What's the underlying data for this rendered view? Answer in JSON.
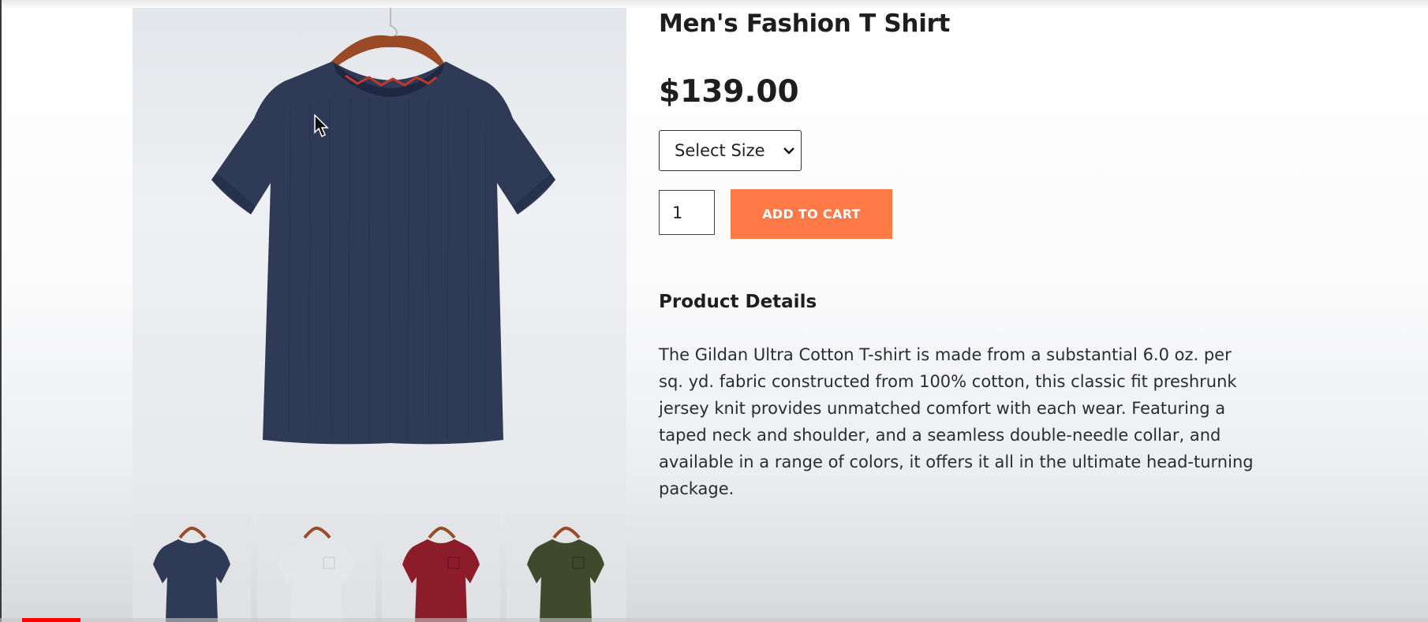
{
  "product": {
    "title": "Men's Fashion T Shirt",
    "price": "$139.00",
    "size_select": {
      "selected": "Select Size",
      "options": [
        "Select Size"
      ]
    },
    "quantity": "1",
    "add_to_cart_label": "ADD TO CART",
    "details_heading": "Product Details",
    "details_text": "The Gildan Ultra Cotton T-shirt is made from a substantial 6.0 oz. per sq. yd. fabric constructed from 100% cotton, this classic fit preshrunk jersey knit provides unmatched comfort with each wear. Featuring a taped neck and shoulder, and a seamless double-needle collar, and available in a range of colors, it offers it all in the ultimate head-turning package."
  },
  "gallery": {
    "main_color": "#2e3a56",
    "thumbnails": [
      {
        "name": "navy",
        "color": "#2e3a56"
      },
      {
        "name": "white",
        "color": "#e4e6ea"
      },
      {
        "name": "red",
        "color": "#8c1c2a"
      },
      {
        "name": "green",
        "color": "#3f4a2c"
      }
    ]
  },
  "theme": {
    "accent": "#ff7946",
    "progress": "#ff0000"
  },
  "video_progress_fraction": 0.04
}
